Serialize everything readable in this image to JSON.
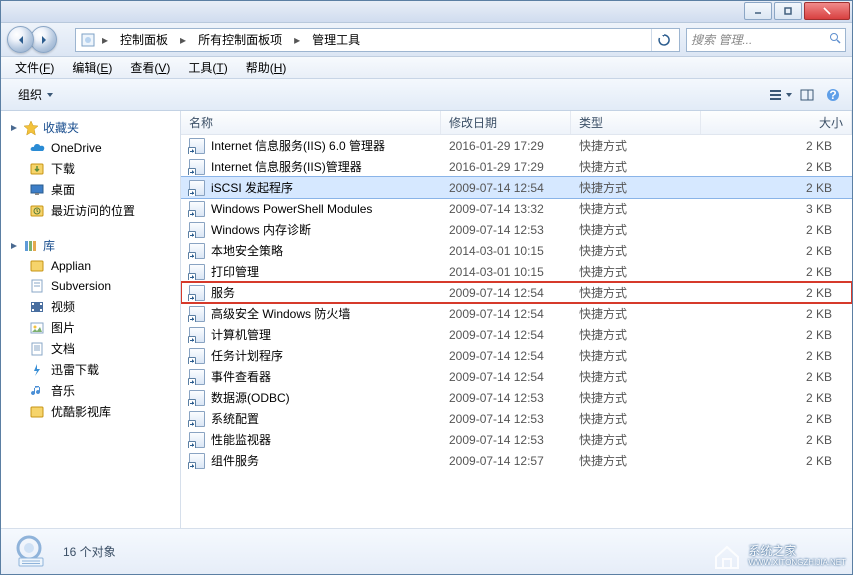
{
  "breadcrumb": {
    "items": [
      "控制面板",
      "所有控制面板项",
      "管理工具"
    ]
  },
  "search": {
    "placeholder": "搜索 管理..."
  },
  "menubar": {
    "items": [
      {
        "label": "文件",
        "ul": "F"
      },
      {
        "label": "编辑",
        "ul": "E"
      },
      {
        "label": "查看",
        "ul": "V"
      },
      {
        "label": "工具",
        "ul": "T"
      },
      {
        "label": "帮助",
        "ul": "H"
      }
    ]
  },
  "toolbar": {
    "organize": "组织"
  },
  "nav": {
    "favorites": {
      "label": "收藏夹",
      "items": [
        "OneDrive",
        "下载",
        "桌面",
        "最近访问的位置"
      ]
    },
    "libraries": {
      "label": "库",
      "items": [
        "Applian",
        "Subversion",
        "视频",
        "图片",
        "文档",
        "迅雷下载",
        "音乐",
        "优酷影视库"
      ]
    }
  },
  "columns": {
    "name": "名称",
    "date": "修改日期",
    "type": "类型",
    "size": "大小"
  },
  "rows": [
    {
      "name": "Internet 信息服务(IIS) 6.0 管理器",
      "date": "2016-01-29 17:29",
      "type": "快捷方式",
      "size": "2 KB",
      "sel": false,
      "hl": false
    },
    {
      "name": "Internet 信息服务(IIS)管理器",
      "date": "2016-01-29 17:29",
      "type": "快捷方式",
      "size": "2 KB",
      "sel": false,
      "hl": false
    },
    {
      "name": "iSCSI 发起程序",
      "date": "2009-07-14 12:54",
      "type": "快捷方式",
      "size": "2 KB",
      "sel": true,
      "hl": false
    },
    {
      "name": "Windows PowerShell Modules",
      "date": "2009-07-14 13:32",
      "type": "快捷方式",
      "size": "3 KB",
      "sel": false,
      "hl": false
    },
    {
      "name": "Windows 内存诊断",
      "date": "2009-07-14 12:53",
      "type": "快捷方式",
      "size": "2 KB",
      "sel": false,
      "hl": false
    },
    {
      "name": "本地安全策略",
      "date": "2014-03-01 10:15",
      "type": "快捷方式",
      "size": "2 KB",
      "sel": false,
      "hl": false
    },
    {
      "name": "打印管理",
      "date": "2014-03-01 10:15",
      "type": "快捷方式",
      "size": "2 KB",
      "sel": false,
      "hl": false
    },
    {
      "name": "服务",
      "date": "2009-07-14 12:54",
      "type": "快捷方式",
      "size": "2 KB",
      "sel": false,
      "hl": true
    },
    {
      "name": "高级安全 Windows 防火墙",
      "date": "2009-07-14 12:54",
      "type": "快捷方式",
      "size": "2 KB",
      "sel": false,
      "hl": false
    },
    {
      "name": "计算机管理",
      "date": "2009-07-14 12:54",
      "type": "快捷方式",
      "size": "2 KB",
      "sel": false,
      "hl": false
    },
    {
      "name": "任务计划程序",
      "date": "2009-07-14 12:54",
      "type": "快捷方式",
      "size": "2 KB",
      "sel": false,
      "hl": false
    },
    {
      "name": "事件查看器",
      "date": "2009-07-14 12:54",
      "type": "快捷方式",
      "size": "2 KB",
      "sel": false,
      "hl": false
    },
    {
      "name": "数据源(ODBC)",
      "date": "2009-07-14 12:53",
      "type": "快捷方式",
      "size": "2 KB",
      "sel": false,
      "hl": false
    },
    {
      "name": "系统配置",
      "date": "2009-07-14 12:53",
      "type": "快捷方式",
      "size": "2 KB",
      "sel": false,
      "hl": false
    },
    {
      "name": "性能监视器",
      "date": "2009-07-14 12:53",
      "type": "快捷方式",
      "size": "2 KB",
      "sel": false,
      "hl": false
    },
    {
      "name": "组件服务",
      "date": "2009-07-14 12:57",
      "type": "快捷方式",
      "size": "2 KB",
      "sel": false,
      "hl": false
    }
  ],
  "status": {
    "text": "16 个对象"
  },
  "watermark": {
    "line1": "系统之家",
    "line2": "WWW.XITONGZHIJIA.NET"
  }
}
